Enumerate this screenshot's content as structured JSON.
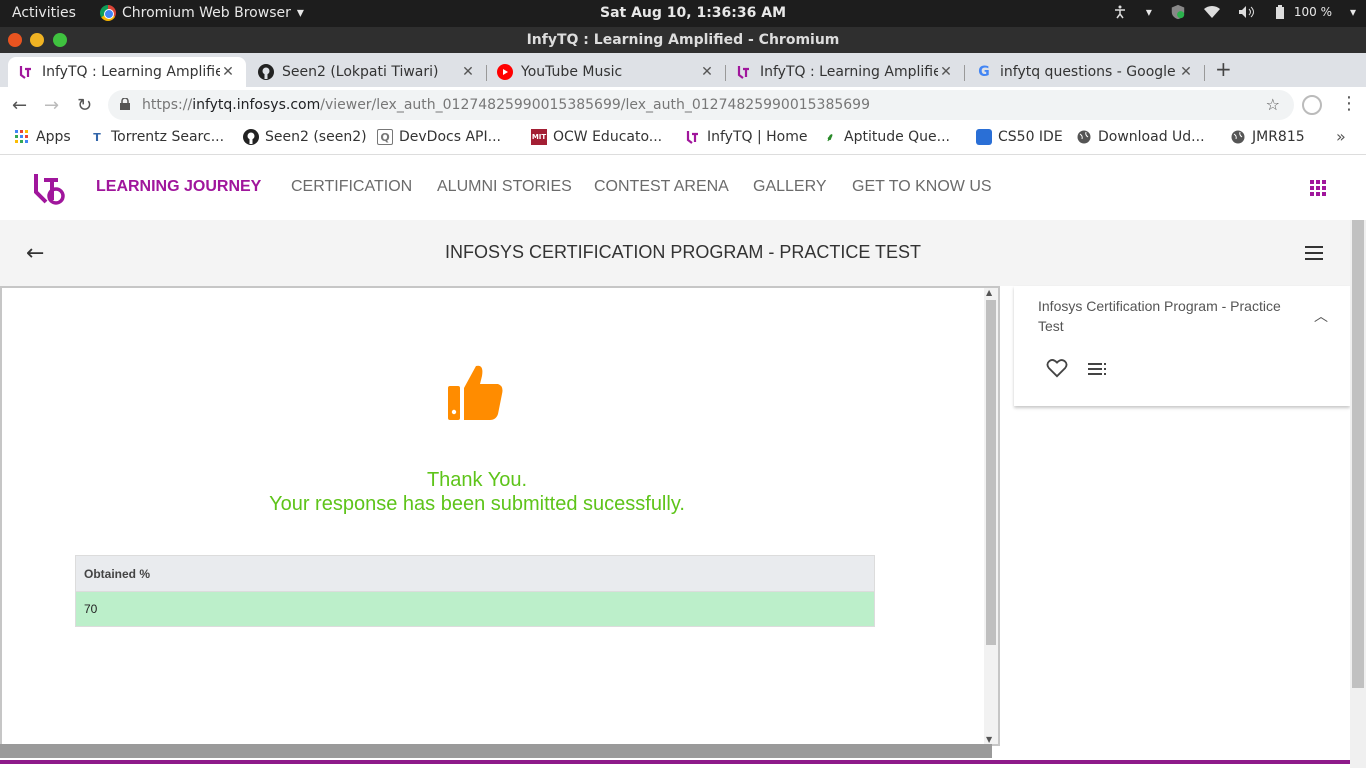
{
  "system_bar": {
    "activities": "Activities",
    "app_name": "Chromium Web Browser",
    "clock": "Sat Aug 10,  1:36:36 AM",
    "battery": "100 %"
  },
  "window": {
    "title": "InfyTQ : Learning Amplified - Chromium"
  },
  "tabs": [
    {
      "label": "InfyTQ : Learning Amplifie",
      "icon": "infytq-icon",
      "active": true
    },
    {
      "label": "Seen2 (Lokpati Tiwari)",
      "icon": "github-icon"
    },
    {
      "label": "YouTube Music",
      "icon": "youtube-music-icon"
    },
    {
      "label": "InfyTQ : Learning Amplifie",
      "icon": "infytq-icon"
    },
    {
      "label": "infytq questions - Google",
      "icon": "google-icon"
    }
  ],
  "address": {
    "scheme": "https://",
    "host": "infytq.infosys.com",
    "path": "/viewer/lex_auth_01274825990015385699/lex_auth_01274825990015385699"
  },
  "bookmarks": [
    {
      "label": "Apps"
    },
    {
      "label": "Torrentz Searc..."
    },
    {
      "label": "Seen2 (seen2)"
    },
    {
      "label": "DevDocs API..."
    },
    {
      "label": "OCW Educato..."
    },
    {
      "label": "InfyTQ | Home"
    },
    {
      "label": "Aptitude Que..."
    },
    {
      "label": "CS50 IDE"
    },
    {
      "label": "Download Ud..."
    },
    {
      "label": "JMR815"
    }
  ],
  "site_nav": {
    "items": [
      "LEARNING JOURNEY",
      "CERTIFICATION",
      "ALUMNI STORIES",
      "CONTEST ARENA",
      "GALLERY",
      "GET TO KNOW US"
    ]
  },
  "page": {
    "title": "INFOSYS CERTIFICATION PROGRAM - PRACTICE TEST",
    "thanks_line1": "Thank You.",
    "thanks_line2": "Your response has been submitted sucessfully.",
    "table": {
      "header": "Obtained %",
      "value": "70"
    }
  },
  "side_panel": {
    "title": "Infosys Certification Program - Practice Test"
  },
  "colors": {
    "brand": "#a0169c",
    "success": "#5ec41a",
    "thumb": "#ff8c00",
    "row_highlight": "#bcefca"
  }
}
